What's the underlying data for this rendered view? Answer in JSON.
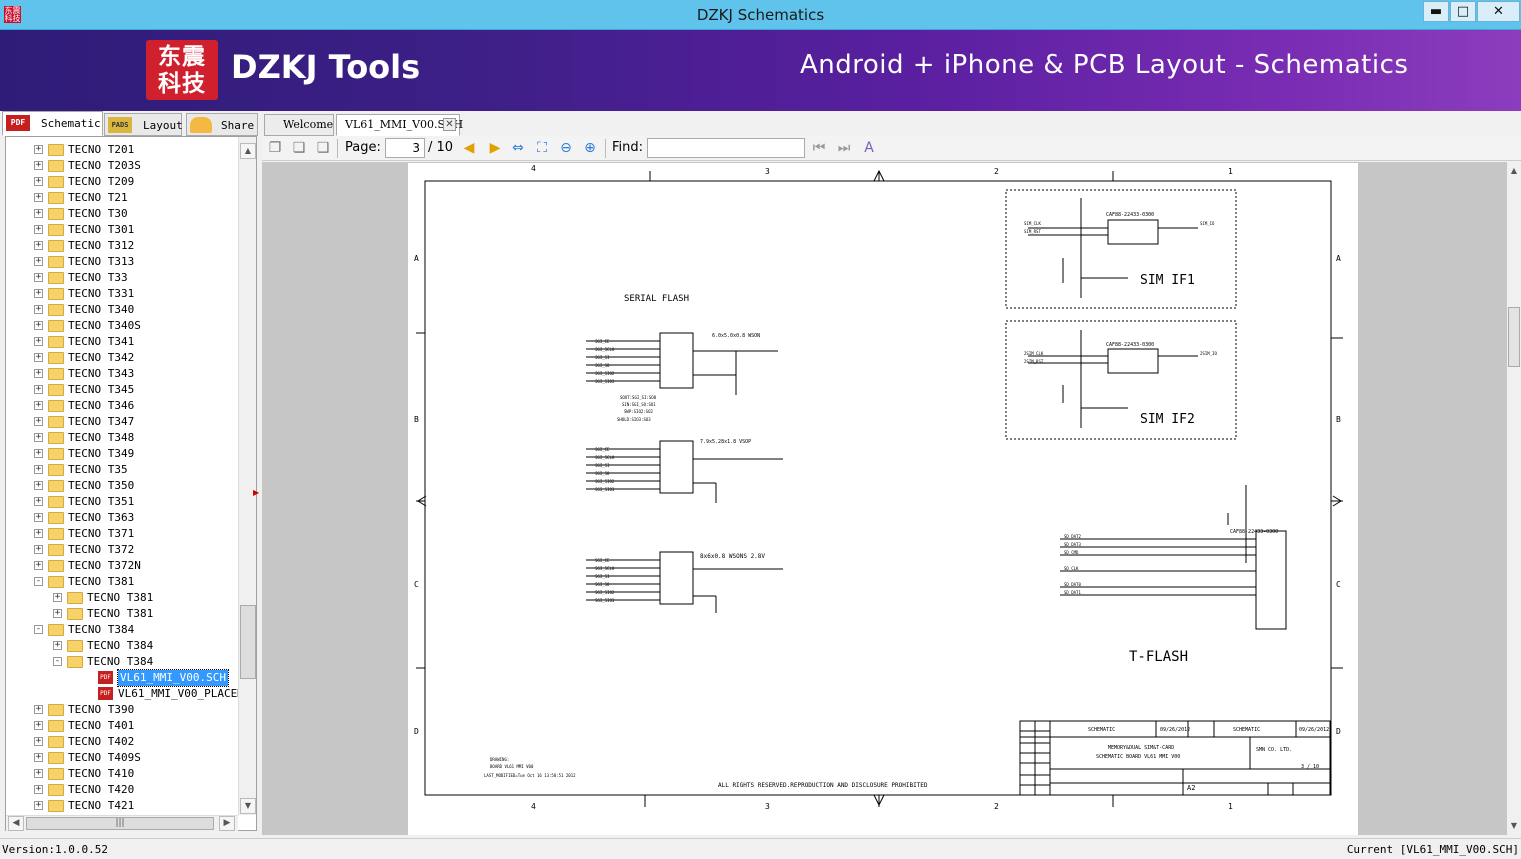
{
  "window": {
    "title": "DZKJ Schematics",
    "minimize": "▬",
    "maximize": "□",
    "close": "✕",
    "app_icon_text": "东震科技"
  },
  "banner": {
    "logo_text": "东震\n科技",
    "brand": "DZKJ Tools",
    "tagline": "Android + iPhone & PCB Layout - Schematics"
  },
  "mode_tabs": [
    {
      "label": "Schematic",
      "icon": "PDF",
      "active": true
    },
    {
      "label": "Layout",
      "icon": "PADS",
      "active": false
    },
    {
      "label": "Share",
      "icon": "share-icon",
      "active": false
    }
  ],
  "doc_tabs": [
    {
      "label": "Welcome",
      "active": false
    },
    {
      "label": "VL61_MMI_V00.SCH",
      "active": true
    }
  ],
  "toolbar": {
    "page_label": "Page:",
    "page_value": "3",
    "page_total": "/ 10",
    "find_label": "Find:",
    "find_value": ""
  },
  "tree": [
    {
      "label": "TECNO T201",
      "level": 0,
      "exp": "+"
    },
    {
      "label": "TECNO T203S",
      "level": 0,
      "exp": "+"
    },
    {
      "label": "TECNO T209",
      "level": 0,
      "exp": "+"
    },
    {
      "label": "TECNO T21",
      "level": 0,
      "exp": "+"
    },
    {
      "label": "TECNO T30",
      "level": 0,
      "exp": "+"
    },
    {
      "label": "TECNO T301",
      "level": 0,
      "exp": "+"
    },
    {
      "label": "TECNO T312",
      "level": 0,
      "exp": "+"
    },
    {
      "label": "TECNO T313",
      "level": 0,
      "exp": "+"
    },
    {
      "label": "TECNO T33",
      "level": 0,
      "exp": "+"
    },
    {
      "label": "TECNO T331",
      "level": 0,
      "exp": "+"
    },
    {
      "label": "TECNO T340",
      "level": 0,
      "exp": "+"
    },
    {
      "label": "TECNO T340S",
      "level": 0,
      "exp": "+"
    },
    {
      "label": "TECNO T341",
      "level": 0,
      "exp": "+"
    },
    {
      "label": "TECNO T342",
      "level": 0,
      "exp": "+"
    },
    {
      "label": "TECNO T343",
      "level": 0,
      "exp": "+"
    },
    {
      "label": "TECNO T345",
      "level": 0,
      "exp": "+"
    },
    {
      "label": "TECNO T346",
      "level": 0,
      "exp": "+"
    },
    {
      "label": "TECNO T347",
      "level": 0,
      "exp": "+"
    },
    {
      "label": "TECNO T348",
      "level": 0,
      "exp": "+"
    },
    {
      "label": "TECNO T349",
      "level": 0,
      "exp": "+"
    },
    {
      "label": "TECNO T35",
      "level": 0,
      "exp": "+"
    },
    {
      "label": "TECNO T350",
      "level": 0,
      "exp": "+"
    },
    {
      "label": "TECNO T351",
      "level": 0,
      "exp": "+"
    },
    {
      "label": "TECNO T363",
      "level": 0,
      "exp": "+"
    },
    {
      "label": "TECNO T371",
      "level": 0,
      "exp": "+"
    },
    {
      "label": "TECNO T372",
      "level": 0,
      "exp": "+"
    },
    {
      "label": "TECNO T372N",
      "level": 0,
      "exp": "+"
    },
    {
      "label": "TECNO T381",
      "level": 0,
      "exp": "-"
    },
    {
      "label": "TECNO T381",
      "level": 1,
      "exp": "+"
    },
    {
      "label": "TECNO T381",
      "level": 1,
      "exp": "+"
    },
    {
      "label": "TECNO T384",
      "level": 0,
      "exp": "-"
    },
    {
      "label": "TECNO T384",
      "level": 1,
      "exp": "+"
    },
    {
      "label": "TECNO T384",
      "level": 1,
      "exp": "-"
    },
    {
      "label": "VL61_MMI_V00.SCH",
      "level": 2,
      "exp": "",
      "pdf": true,
      "selected": true
    },
    {
      "label": "VL61_MMI_V00_PLACEMENT",
      "level": 2,
      "exp": "",
      "pdf": true
    },
    {
      "label": "TECNO T390",
      "level": 0,
      "exp": "+"
    },
    {
      "label": "TECNO T401",
      "level": 0,
      "exp": "+"
    },
    {
      "label": "TECNO T402",
      "level": 0,
      "exp": "+"
    },
    {
      "label": "TECNO T409S",
      "level": 0,
      "exp": "+"
    },
    {
      "label": "TECNO T410",
      "level": 0,
      "exp": "+"
    },
    {
      "label": "TECNO T420",
      "level": 0,
      "exp": "+"
    },
    {
      "label": "TECNO T421",
      "level": 0,
      "exp": "+"
    }
  ],
  "schematic": {
    "col_labels": [
      "4",
      "3",
      "2",
      "1"
    ],
    "row_labels": [
      "A",
      "B",
      "C",
      "D"
    ],
    "serial_flash": "SERIAL FLASH",
    "sim_if1": "SIM IF1",
    "sim_if2": "SIM IF2",
    "tflash": "T-FLASH",
    "flash1_pkg": "6.0x5.0x0.8 WSON",
    "flash2_pkg": "7.9x5.28x1.8 VSOP",
    "flash3_pkg": "8x6x0.8 WSONS 2.8V",
    "sim_part": "CAF88-22433-0300",
    "tf_part": "CAF88-22433-0300",
    "flash_pins": [
      "SGI_CE",
      "SGI_SCLK",
      "SGI_SI",
      "SGI_SO",
      "SGI_SIO2",
      "SGI_SIO3"
    ],
    "flash_notes": [
      "SOUT:SGI_SI:SO8",
      "SIN:SGI_SO:SO1",
      "SWP:SIO2:SO2",
      "SHOLD:SIO3:SO3"
    ],
    "sim1_nets": [
      "SIM_CLK",
      "SIM_RST",
      "SIM_IO"
    ],
    "sim2_nets": [
      "2SIM_CLK",
      "2SIM_RST",
      "2SIM_IO"
    ],
    "tf_nets": [
      "SD_DAT2",
      "SD_DAT3",
      "SD_CMD",
      "SD_CLK",
      "SD_DAT0",
      "SD_DAT1"
    ],
    "copyright": "ALL RIGHTS RESERVED.REPRODUCTION AND DISCLOSURE PROHIBITED",
    "tb_name": "SCHEMATIC",
    "tb_date": "09/26/2012",
    "tb_title": "MEMORY&DUAL SIM&T-CARD",
    "tb_product": "SCHEMATIC BOARD VL61 MMI V00",
    "tb_company": "SMN CO. LTD.",
    "tb_sheet": "3 / 10",
    "tb_size": "A2",
    "drawing_note": "DRAWING:",
    "drawing_board": "BOARD VL61 MMI V00",
    "drawing_mod": "LAST_MODIFIED=Tue Oct 16 13:58:51 2012"
  },
  "status": {
    "version": "Version:1.0.0.52",
    "current": "Current [VL61_MMI_V00.SCH]"
  }
}
